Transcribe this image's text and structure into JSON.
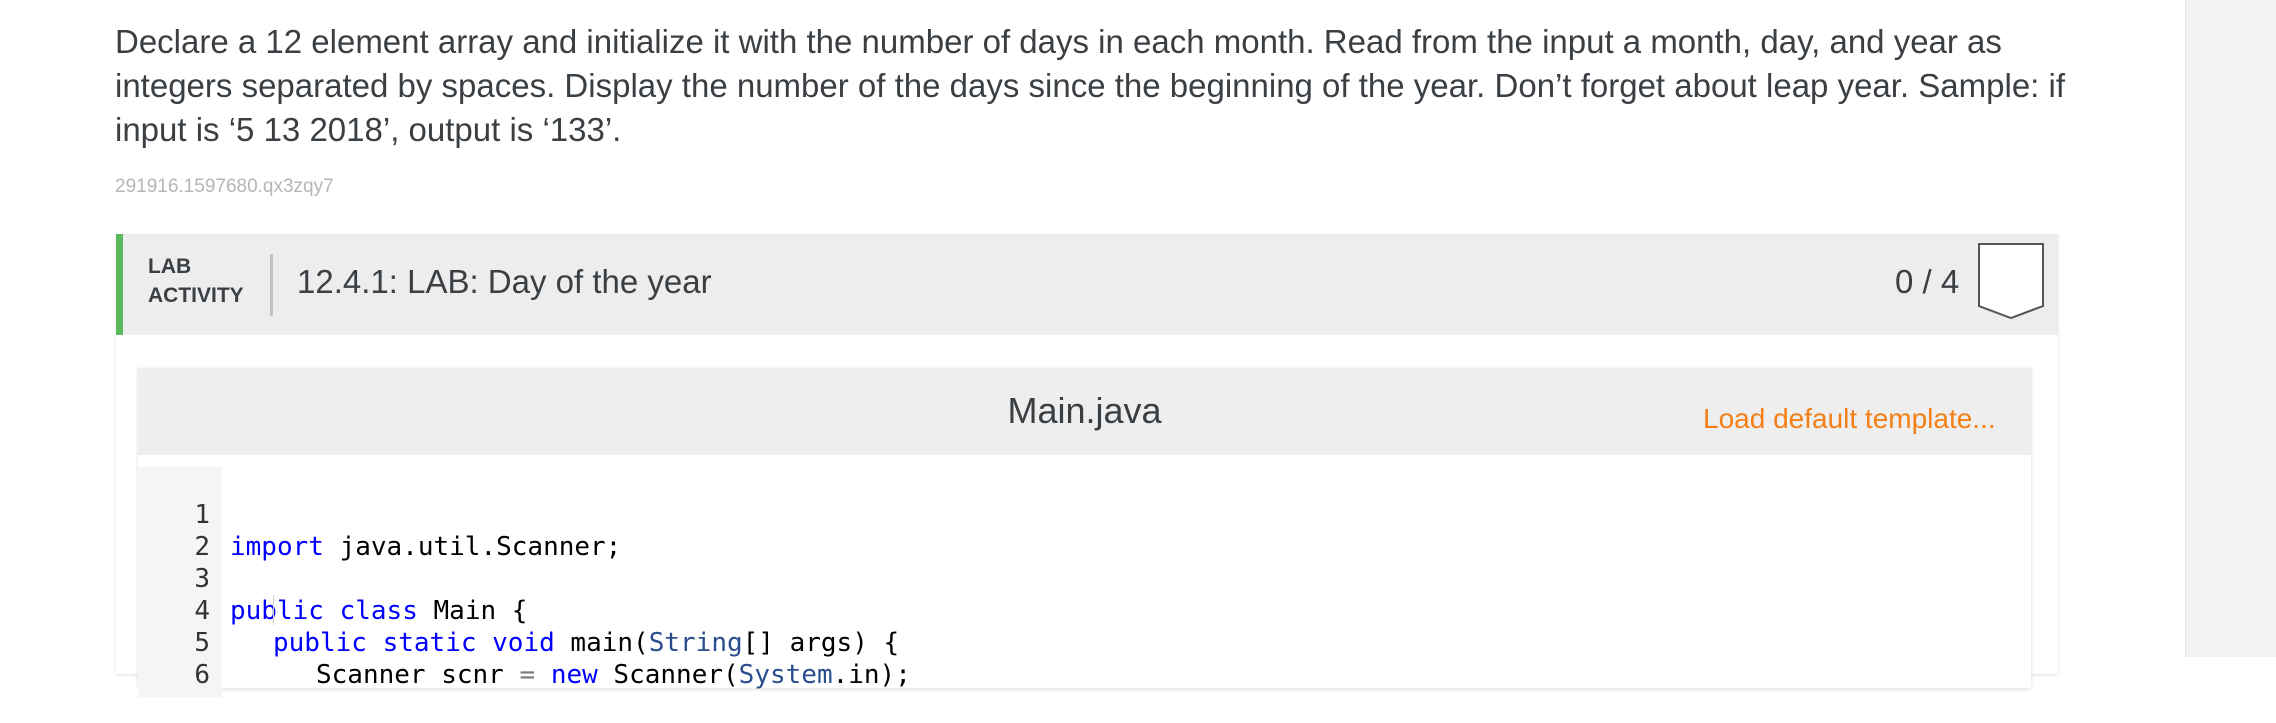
{
  "prompt_text": "Declare a 12 element array and initialize it with the number of days in each month. Read from the input a month, day, and year as integers separated by spaces. Display the number of the days since the beginning of the year. Don’t forget about leap year. Sample: if input is ‘5 13 2018’, output is ‘133’.",
  "reference_id": "291916.1597680.qx3zqy7",
  "lab": {
    "tag_line1": "LAB",
    "tag_line2": "ACTIVITY",
    "title": "12.4.1: LAB: Day of the year",
    "score": "0 / 4",
    "accent_color": "#5cb85c"
  },
  "editor": {
    "file_name": "Main.java",
    "load_template_label": "Load default template...",
    "load_template_color": "#f57f17",
    "lines": [
      {
        "num": "1"
      },
      {
        "num": "2"
      },
      {
        "num": "3"
      },
      {
        "num": "4"
      },
      {
        "num": "5"
      },
      {
        "num": "6"
      }
    ],
    "code": {
      "l1_kw": "import",
      "l1_rest": " java.util.Scanner;",
      "l3_kw1": "public",
      "l3_kw2": "class",
      "l3_rest": " Main {",
      "l4_kw1": "public",
      "l4_kw2": "static",
      "l4_kw3": "void",
      "l4_mid": " main(",
      "l4_type": "String",
      "l4_rest": "[] args) {",
      "l5_start": "Scanner scnr ",
      "l5_op": "=",
      "l5_kw": "new",
      "l5_mid": " Scanner(",
      "l5_type": "System",
      "l5_rest": ".in);"
    }
  }
}
